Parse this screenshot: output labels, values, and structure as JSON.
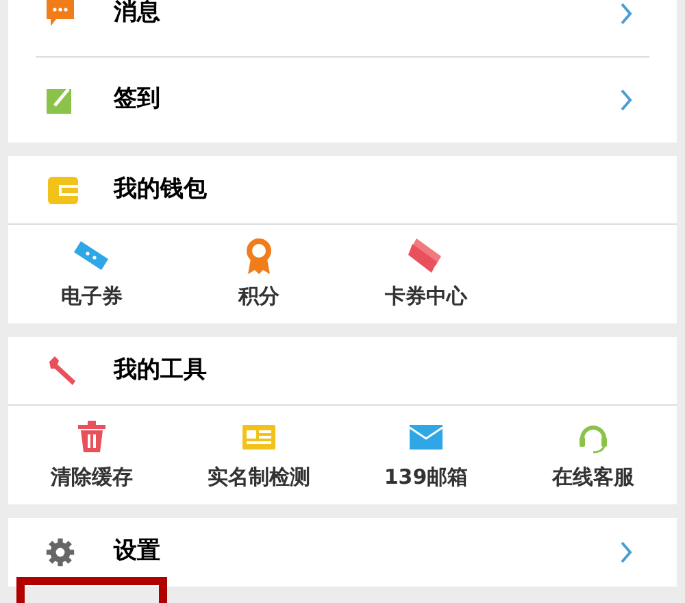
{
  "menu_card": {
    "rows": [
      {
        "label": "消息"
      },
      {
        "label": "签到"
      }
    ]
  },
  "sections": [
    {
      "title": "我的钱包",
      "items": [
        {
          "label": "电子券"
        },
        {
          "label": "积分"
        },
        {
          "label": "卡券中心"
        }
      ]
    },
    {
      "title": "我的工具",
      "items": [
        {
          "label": "清除缓存"
        },
        {
          "label": "实名制检测"
        },
        {
          "label": "139邮箱"
        },
        {
          "label": "在线客服"
        }
      ]
    }
  ],
  "settings": {
    "label": "设置"
  }
}
